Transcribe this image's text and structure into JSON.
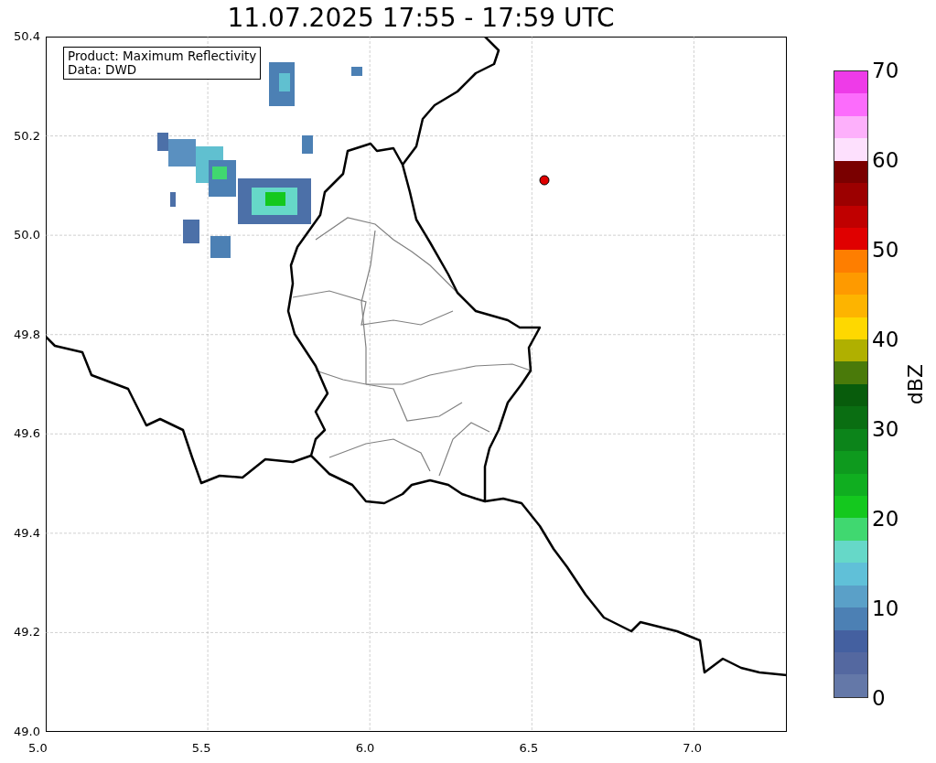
{
  "title": "11.07.2025 17:55 - 17:59 UTC",
  "annotation": [
    "Product: Maximum Reflectivity",
    "Data: DWD"
  ],
  "map": {
    "xticks": [
      "5.0",
      "5.5",
      "6.0",
      "6.5",
      "7.0"
    ],
    "yticks": [
      "50.4",
      "50.2",
      "50.0",
      "49.8",
      "49.6",
      "49.4",
      "49.2",
      "49.0"
    ]
  },
  "colorbar": {
    "label": "dBZ",
    "ticks": [
      "70",
      "60",
      "50",
      "40",
      "30",
      "20",
      "10",
      "0"
    ],
    "bins": [
      {
        "color": "#ee3be8"
      },
      {
        "color": "#fc6cfc"
      },
      {
        "color": "#fdb0fb"
      },
      {
        "color": "#fde0fd"
      },
      {
        "color": "#7a0000"
      },
      {
        "color": "#9c0000"
      },
      {
        "color": "#c00000"
      },
      {
        "color": "#e00000"
      },
      {
        "color": "#fe7e00"
      },
      {
        "color": "#fe9a00"
      },
      {
        "color": "#fdb400"
      },
      {
        "color": "#fed800"
      },
      {
        "color": "#b0b000"
      },
      {
        "color": "#4a7a0a"
      },
      {
        "color": "#085c0c"
      },
      {
        "color": "#0a6e12"
      },
      {
        "color": "#0c841a"
      },
      {
        "color": "#0e9a1e"
      },
      {
        "color": "#10ae20"
      },
      {
        "color": "#14c81e"
      },
      {
        "color": "#40d870"
      },
      {
        "color": "#66d8c8"
      },
      {
        "color": "#60c0d8"
      },
      {
        "color": "#5aa0c8"
      },
      {
        "color": "#4c80b4"
      },
      {
        "color": "#4460a0"
      },
      {
        "color": "#5468a0"
      },
      {
        "color": "#6478a8"
      }
    ]
  }
}
